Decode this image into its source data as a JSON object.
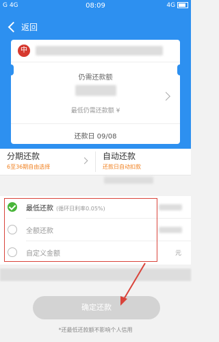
{
  "status_bar": {
    "left": "G  4G",
    "time": "08:09",
    "right": "4G"
  },
  "nav": {
    "back_label": "返回"
  },
  "bank": {
    "logo_glyph": "中"
  },
  "bill": {
    "due_label": "仍需还款额",
    "min_label": "最低仍需还款额 ¥",
    "repay_date": "还款日 09/08"
  },
  "methods": [
    {
      "title": "分期还款",
      "subtitle": "6至36期自由选择"
    },
    {
      "title": "自动还款",
      "subtitle": "还款日自动扣款"
    }
  ],
  "options": [
    {
      "label": "最低还款",
      "note": "(循环日利率0.05%)",
      "selected": true,
      "unit": ""
    },
    {
      "label": "全额还款",
      "note": "",
      "selected": false,
      "unit": ""
    },
    {
      "label": "自定义金额",
      "note": "",
      "selected": false,
      "unit": "元"
    }
  ],
  "confirm_label": "确定还款",
  "footnote": "*还最低还款额不影响个人信用",
  "colors": {
    "primary": "#2d90f0",
    "accent_orange": "#f08020",
    "highlight_red": "#d9433a",
    "radio_green": "#49b53a"
  }
}
